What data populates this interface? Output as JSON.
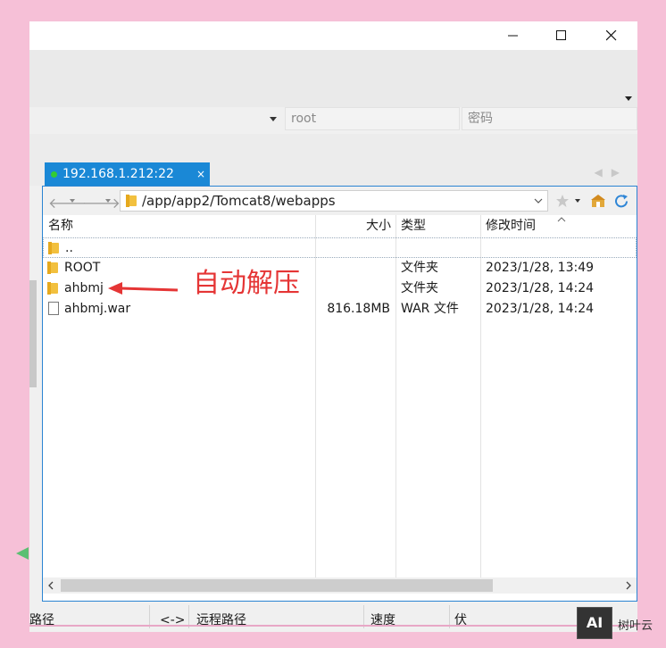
{
  "connection": {
    "username": "root",
    "password_placeholder": "密码"
  },
  "tab": {
    "label": "192.168.1.212:22",
    "close": "×"
  },
  "path": {
    "current": "/app/app2/Tomcat8/webapps"
  },
  "file_list": {
    "columns": [
      "名称",
      "大小",
      "类型",
      "修改时间"
    ],
    "rows": [
      {
        "name": "..",
        "size": "",
        "type": "",
        "modified": "",
        "icon": "folder-icon"
      },
      {
        "name": "ROOT",
        "size": "",
        "type": "文件夹",
        "modified": "2023/1/28, 13:49",
        "icon": "folder-icon"
      },
      {
        "name": "ahbmj",
        "size": "",
        "type": "文件夹",
        "modified": "2023/1/28, 14:24",
        "icon": "folder-icon"
      },
      {
        "name": "ahbmj.war",
        "size": "816.18MB",
        "type": "WAR 文件",
        "modified": "2023/1/28, 14:24",
        "icon": "file-icon"
      }
    ]
  },
  "annotation": {
    "text": "自动解压",
    "color": "#e53535"
  },
  "status_bar": {
    "path": "路径",
    "direction": "<->",
    "remote_path": "远程路径",
    "speed": "速度",
    "status": "伏"
  },
  "watermark": {
    "logo": "AI",
    "text": "树叶云"
  },
  "colors": {
    "background": "#f6c0d7",
    "accent": "#1a88d6",
    "connected": "#33cc33"
  }
}
